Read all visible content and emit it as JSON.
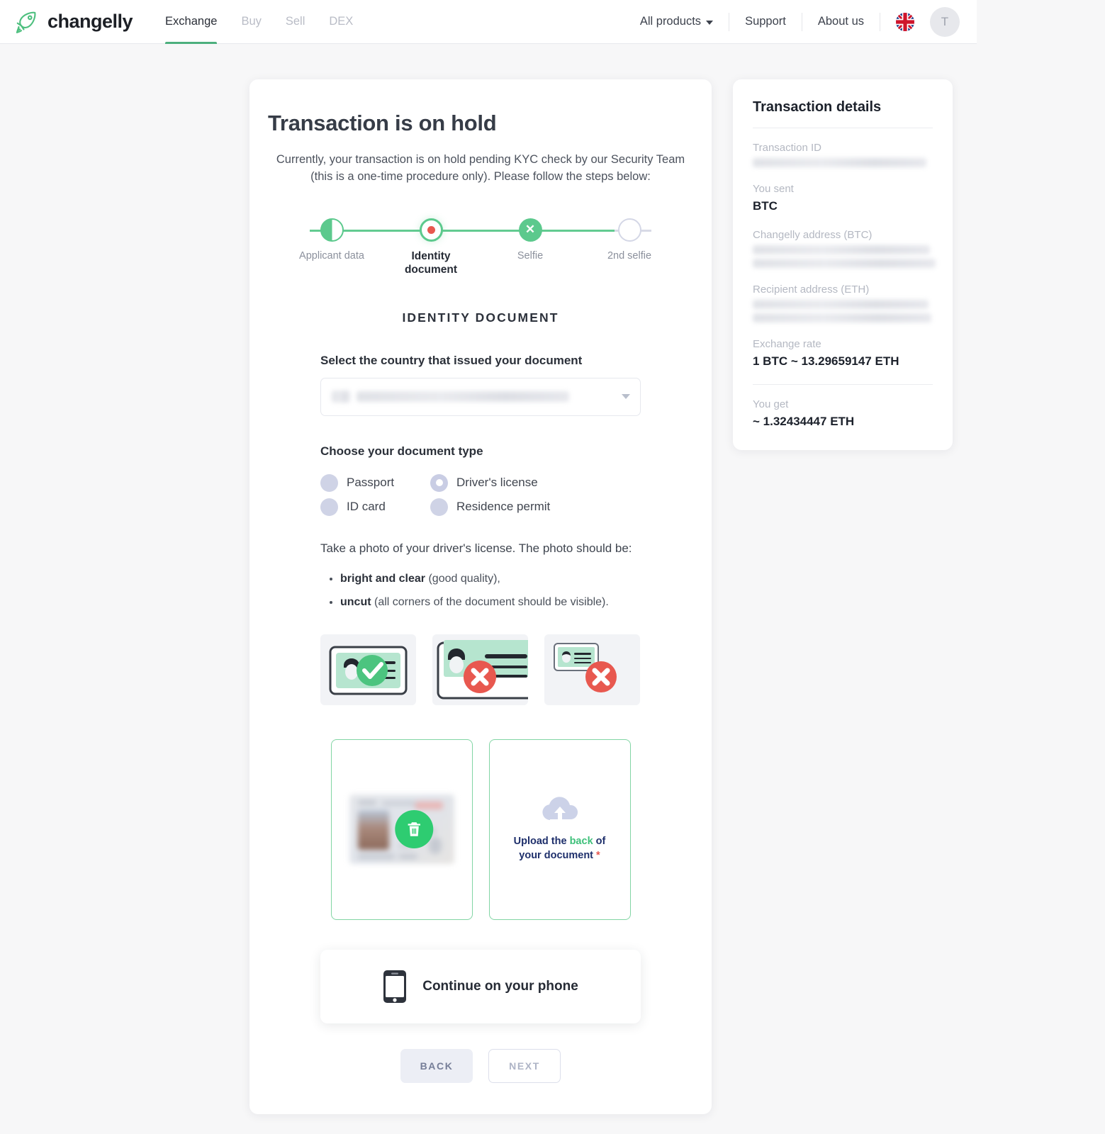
{
  "header": {
    "brand": "changelly",
    "logo_icon": "rocket-icon",
    "nav": [
      {
        "label": "Exchange",
        "active": true
      },
      {
        "label": "Buy",
        "active": false
      },
      {
        "label": "Sell",
        "active": false
      },
      {
        "label": "DEX",
        "active": false
      }
    ],
    "all_products": "All products",
    "chevron_icon": "chevron-down-icon",
    "support": "Support",
    "about": "About us",
    "flag_icon": "uk-flag-icon",
    "avatar_initial": "T"
  },
  "main": {
    "title": "Transaction is on hold",
    "subtitle": "Currently, your transaction is on hold pending KYC check by our Security Team (this is a one-time procedure only). Please follow the steps below:",
    "steps": [
      {
        "label": "Applicant data",
        "state": "half"
      },
      {
        "label": "Identity document",
        "state": "current"
      },
      {
        "label": "Selfie",
        "state": "failed",
        "icon": "close-icon"
      },
      {
        "label": "2nd selfie",
        "state": "empty"
      }
    ],
    "section_heading": "IDENTITY DOCUMENT",
    "country_label": "Select the country that issued your document",
    "country_value": "",
    "country_caret_icon": "caret-down-icon",
    "doc_type_label": "Choose your document type",
    "doc_types": [
      {
        "label": "Passport",
        "selected": false
      },
      {
        "label": "Driver's license",
        "selected": true
      },
      {
        "label": "ID card",
        "selected": false
      },
      {
        "label": "Residence permit",
        "selected": false
      }
    ],
    "instructions": "Take a photo of your driver's license. The photo should be:",
    "bullets": [
      {
        "bold": "bright and clear",
        "rest": " (good quality),"
      },
      {
        "bold": "uncut",
        "rest": " (all corners of the document should be visible)."
      }
    ],
    "examples": [
      {
        "name": "good-example",
        "status": "ok",
        "icon": "check-icon"
      },
      {
        "name": "cut-example",
        "status": "bad",
        "icon": "close-icon"
      },
      {
        "name": "small-example",
        "status": "bad",
        "icon": "close-icon"
      }
    ],
    "upload_front": {
      "state": "uploaded",
      "delete_icon": "trash-icon"
    },
    "upload_back": {
      "cloud_icon": "cloud-upload-icon",
      "text_pre": "Upload the ",
      "text_hl": "back",
      "text_post": " of your document ",
      "required_mark": "*"
    },
    "phone_cta": "Continue on your phone",
    "phone_icon": "mobile-phone-icon",
    "back_button": "BACK",
    "next_button": "NEXT"
  },
  "sidebar": {
    "title": "Transaction details",
    "transaction_id_label": "Transaction ID",
    "you_sent_label": "You sent",
    "you_sent_value": "BTC",
    "changelly_address_label": "Changelly address (BTC)",
    "recipient_address_label": "Recipient address (ETH)",
    "exchange_rate_label": "Exchange rate",
    "exchange_rate_value": "1 BTC ~ 13.29659147 ETH",
    "you_get_label": "You get",
    "you_get_value": "~ 1.32434447 ETH"
  },
  "colors": {
    "green": "#5cc98d",
    "red": "#e8584f",
    "navy": "#1e2f6b",
    "muted": "#b4b8c2"
  }
}
